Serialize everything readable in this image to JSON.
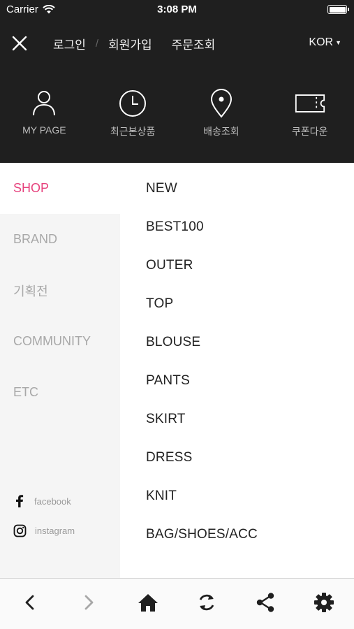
{
  "status": {
    "carrier": "Carrier",
    "time": "3:08 PM"
  },
  "header": {
    "links": {
      "login": "로그인",
      "signup": "회원가입",
      "order_lookup": "주문조회",
      "separator": "/"
    },
    "language": "KOR",
    "quick_menu": [
      {
        "label": "MY PAGE",
        "icon": "user-icon"
      },
      {
        "label": "최근본상품",
        "icon": "clock-icon"
      },
      {
        "label": "배송조회",
        "icon": "location-pin-icon"
      },
      {
        "label": "쿠폰다운",
        "icon": "ticket-icon"
      }
    ]
  },
  "categories": [
    {
      "label": "SHOP",
      "active": true
    },
    {
      "label": "BRAND",
      "active": false
    },
    {
      "label": "기획전",
      "active": false
    },
    {
      "label": "COMMUNITY",
      "active": false
    },
    {
      "label": "ETC",
      "active": false
    }
  ],
  "social": [
    {
      "label": "facebook",
      "icon": "facebook-icon"
    },
    {
      "label": "instagram",
      "icon": "instagram-icon"
    }
  ],
  "shop_menu": [
    "NEW",
    "BEST100",
    "OUTER",
    "TOP",
    "BLOUSE",
    "PANTS",
    "SKIRT",
    "DRESS",
    "KNIT",
    "BAG/SHOES/ACC"
  ],
  "toolbar": [
    "back-icon",
    "forward-icon",
    "home-icon",
    "refresh-icon",
    "share-icon",
    "settings-icon"
  ],
  "colors": {
    "header_bg": "#1f1f1f",
    "accent": "#e6417c",
    "panel_bg": "#f5f5f5"
  }
}
